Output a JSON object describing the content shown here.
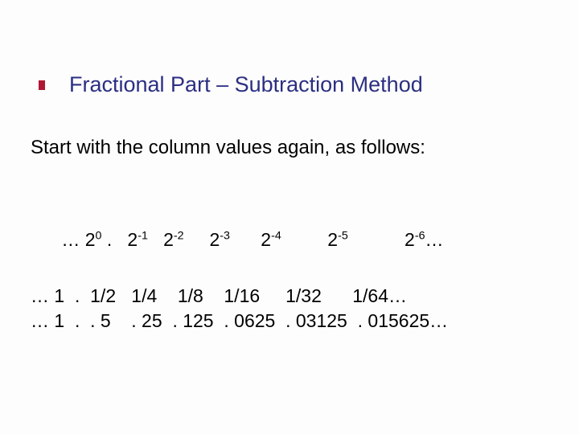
{
  "title": "Fractional Part – Subtraction Method",
  "intro": "Start with the column values again, as follows:",
  "powers": {
    "prefix": "…",
    "base": "2",
    "exps": [
      "0",
      "-1",
      "-2",
      "-3",
      "-4",
      "-5",
      "-6"
    ],
    "dot": ".",
    "suffix": "…"
  },
  "fractions": {
    "prefix": "…",
    "vals": [
      "1",
      "1/2",
      "1/4",
      "1/8",
      "1/16",
      "1/32",
      "1/64"
    ],
    "dot": ".",
    "suffix": "…"
  },
  "decimals": {
    "prefix": "…",
    "vals": [
      "1",
      ". 5",
      ". 25",
      ". 125",
      ". 0625",
      ". 03125",
      ". 015625"
    ],
    "dot": ".",
    "suffix": "…"
  }
}
